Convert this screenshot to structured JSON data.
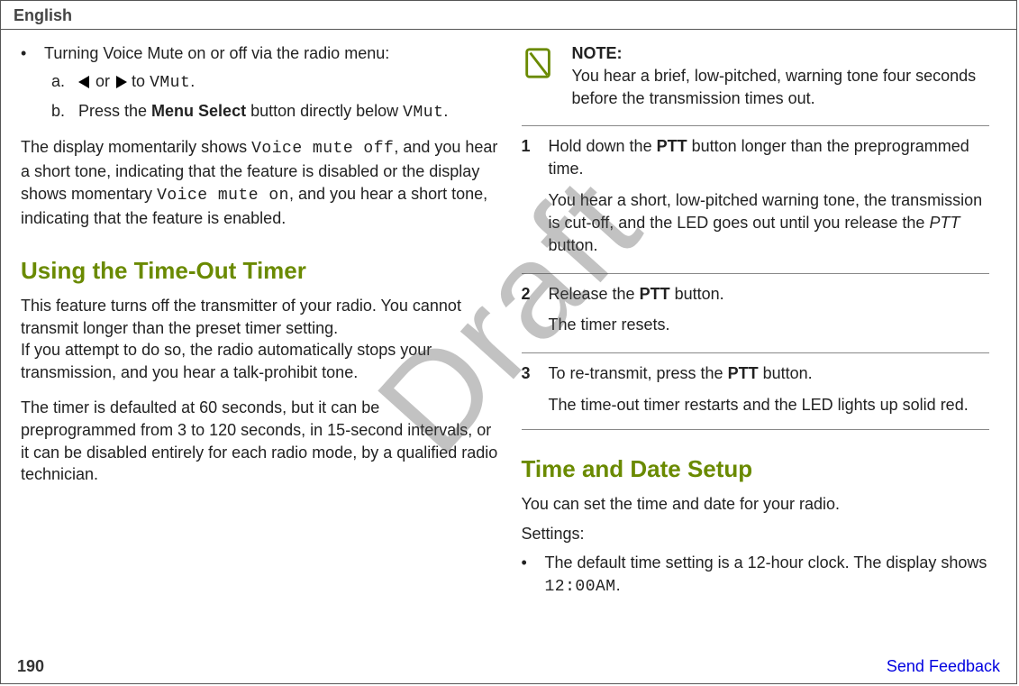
{
  "header": {
    "language": "English"
  },
  "watermark": "Draft",
  "left": {
    "bullet_intro": "Turning Voice Mute on or off via the radio menu:",
    "sub_a_marker": "a.",
    "sub_a_prefix": " or ",
    "sub_a_mid": " to ",
    "sub_a_target": "VMut",
    "sub_a_suffix": ".",
    "sub_b_marker": "b.",
    "sub_b_prefix": "Press the ",
    "sub_b_bold": "Menu Select",
    "sub_b_mid": " button directly below ",
    "sub_b_target": "VMut",
    "sub_b_suffix": ".",
    "result_p1a": "The display momentarily shows ",
    "result_p1_code1": "Voice mute off",
    "result_p1b": ", and you hear a short tone, indicating that the feature is disabled or the display shows momentary ",
    "result_p1_code2": "Voice mute on",
    "result_p1c": ", and you hear a short tone, indicating that the feature is enabled.",
    "h2_timeout": "Using the Time-Out Timer",
    "timeout_p1": "This feature turns off the transmitter of your radio. You cannot transmit longer than the preset timer setting.",
    "timeout_p2": "If you attempt to do so, the radio automatically stops your transmission, and you hear a talk-prohibit tone.",
    "timeout_p3": "The timer is defaulted at 60 seconds, but it can be preprogrammed from 3 to 120 seconds, in 15-second intervals, or it can be disabled entirely for each radio mode, by a qualified radio technician."
  },
  "right": {
    "note_label": "NOTE:",
    "note_body": "You hear a brief, low-pitched, warning tone four seconds before the transmission times out.",
    "steps": [
      {
        "num": "1",
        "line1_pre": "Hold down the ",
        "line1_bold": "PTT",
        "line1_post": " button longer than the preprogrammed time.",
        "line2_pre": "You hear a short, low-pitched warning tone, the transmission is cut-off, and the LED goes out until you release the ",
        "line2_italic": "PTT",
        "line2_post": " button."
      },
      {
        "num": "2",
        "line1_pre": "Release the ",
        "line1_bold": "PTT",
        "line1_post": " button.",
        "line2_pre": "The timer resets.",
        "line2_italic": "",
        "line2_post": ""
      },
      {
        "num": "3",
        "line1_pre": "To re-transmit, press the ",
        "line1_bold": "PTT",
        "line1_post": " button.",
        "line2_pre": "The time-out timer restarts and the LED lights up solid red.",
        "line2_italic": "",
        "line2_post": ""
      }
    ],
    "h2_timedate": "Time and Date Setup",
    "td_p1": "You can set the time and date for your radio.",
    "td_p2": "Settings:",
    "td_bullet_pre": "The default time setting is a 12-hour clock. The display shows ",
    "td_bullet_code": "12:00AM",
    "td_bullet_post": "."
  },
  "footer": {
    "page": "190",
    "feedback": "Send Feedback"
  }
}
